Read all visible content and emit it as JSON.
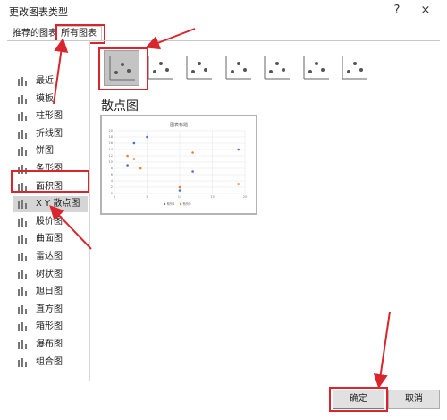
{
  "dialog": {
    "title": "更改图表类型",
    "help": "?",
    "close": "×"
  },
  "tabs": [
    {
      "label": "推荐的图表"
    },
    {
      "label": "所有图表"
    }
  ],
  "chart_types": [
    {
      "label": "最近",
      "icon": "recent-icon"
    },
    {
      "label": "模板",
      "icon": "folder-icon"
    },
    {
      "label": "柱形图",
      "icon": "column-chart-icon"
    },
    {
      "label": "折线图",
      "icon": "line-chart-icon"
    },
    {
      "label": "饼图",
      "icon": "pie-chart-icon"
    },
    {
      "label": "条形图",
      "icon": "bar-chart-icon"
    },
    {
      "label": "面积图",
      "icon": "area-chart-icon"
    },
    {
      "label": "X Y 散点图",
      "icon": "scatter-chart-icon"
    },
    {
      "label": "股价图",
      "icon": "stock-chart-icon"
    },
    {
      "label": "曲面图",
      "icon": "surface-chart-icon"
    },
    {
      "label": "雷达图",
      "icon": "radar-chart-icon"
    },
    {
      "label": "树状图",
      "icon": "treemap-chart-icon"
    },
    {
      "label": "旭日图",
      "icon": "sunburst-chart-icon"
    },
    {
      "label": "直方图",
      "icon": "histogram-chart-icon"
    },
    {
      "label": "箱形图",
      "icon": "box-chart-icon"
    },
    {
      "label": "瀑布图",
      "icon": "waterfall-chart-icon"
    },
    {
      "label": "组合图",
      "icon": "combo-chart-icon"
    }
  ],
  "selected_type_index": 7,
  "subtypes": [
    {
      "icon": "scatter-icon"
    },
    {
      "icon": "scatter-smooth-markers-icon"
    },
    {
      "icon": "scatter-smooth-icon"
    },
    {
      "icon": "scatter-straight-markers-icon"
    },
    {
      "icon": "scatter-straight-icon"
    },
    {
      "icon": "bubble-icon"
    },
    {
      "icon": "bubble-3d-icon"
    }
  ],
  "subtype_heading": "散点图",
  "buttons": {
    "ok": "确定",
    "cancel": "取消"
  },
  "colors": {
    "highlight_red": "#d9262c",
    "series1": "#4472c4",
    "series2": "#ed7d31"
  },
  "chart_data": {
    "type": "scatter",
    "title": "图表标题",
    "xlim": [
      0,
      20
    ],
    "ylim": [
      0,
      20
    ],
    "xticks": [
      0,
      5,
      10,
      15,
      20
    ],
    "yticks": [
      0,
      2,
      4,
      6,
      8,
      10,
      12,
      14,
      16,
      18,
      20
    ],
    "grid": true,
    "legend_position": "bottom",
    "series": [
      {
        "name": "系列1",
        "points": [
          [
            2,
            9
          ],
          [
            3,
            16
          ],
          [
            5,
            18
          ],
          [
            10,
            1
          ],
          [
            12,
            7
          ],
          [
            19,
            14
          ]
        ]
      },
      {
        "name": "系列2",
        "points": [
          [
            2,
            12
          ],
          [
            3,
            11
          ],
          [
            4,
            8
          ],
          [
            10,
            2
          ],
          [
            12,
            13
          ],
          [
            19,
            3
          ]
        ]
      }
    ]
  }
}
